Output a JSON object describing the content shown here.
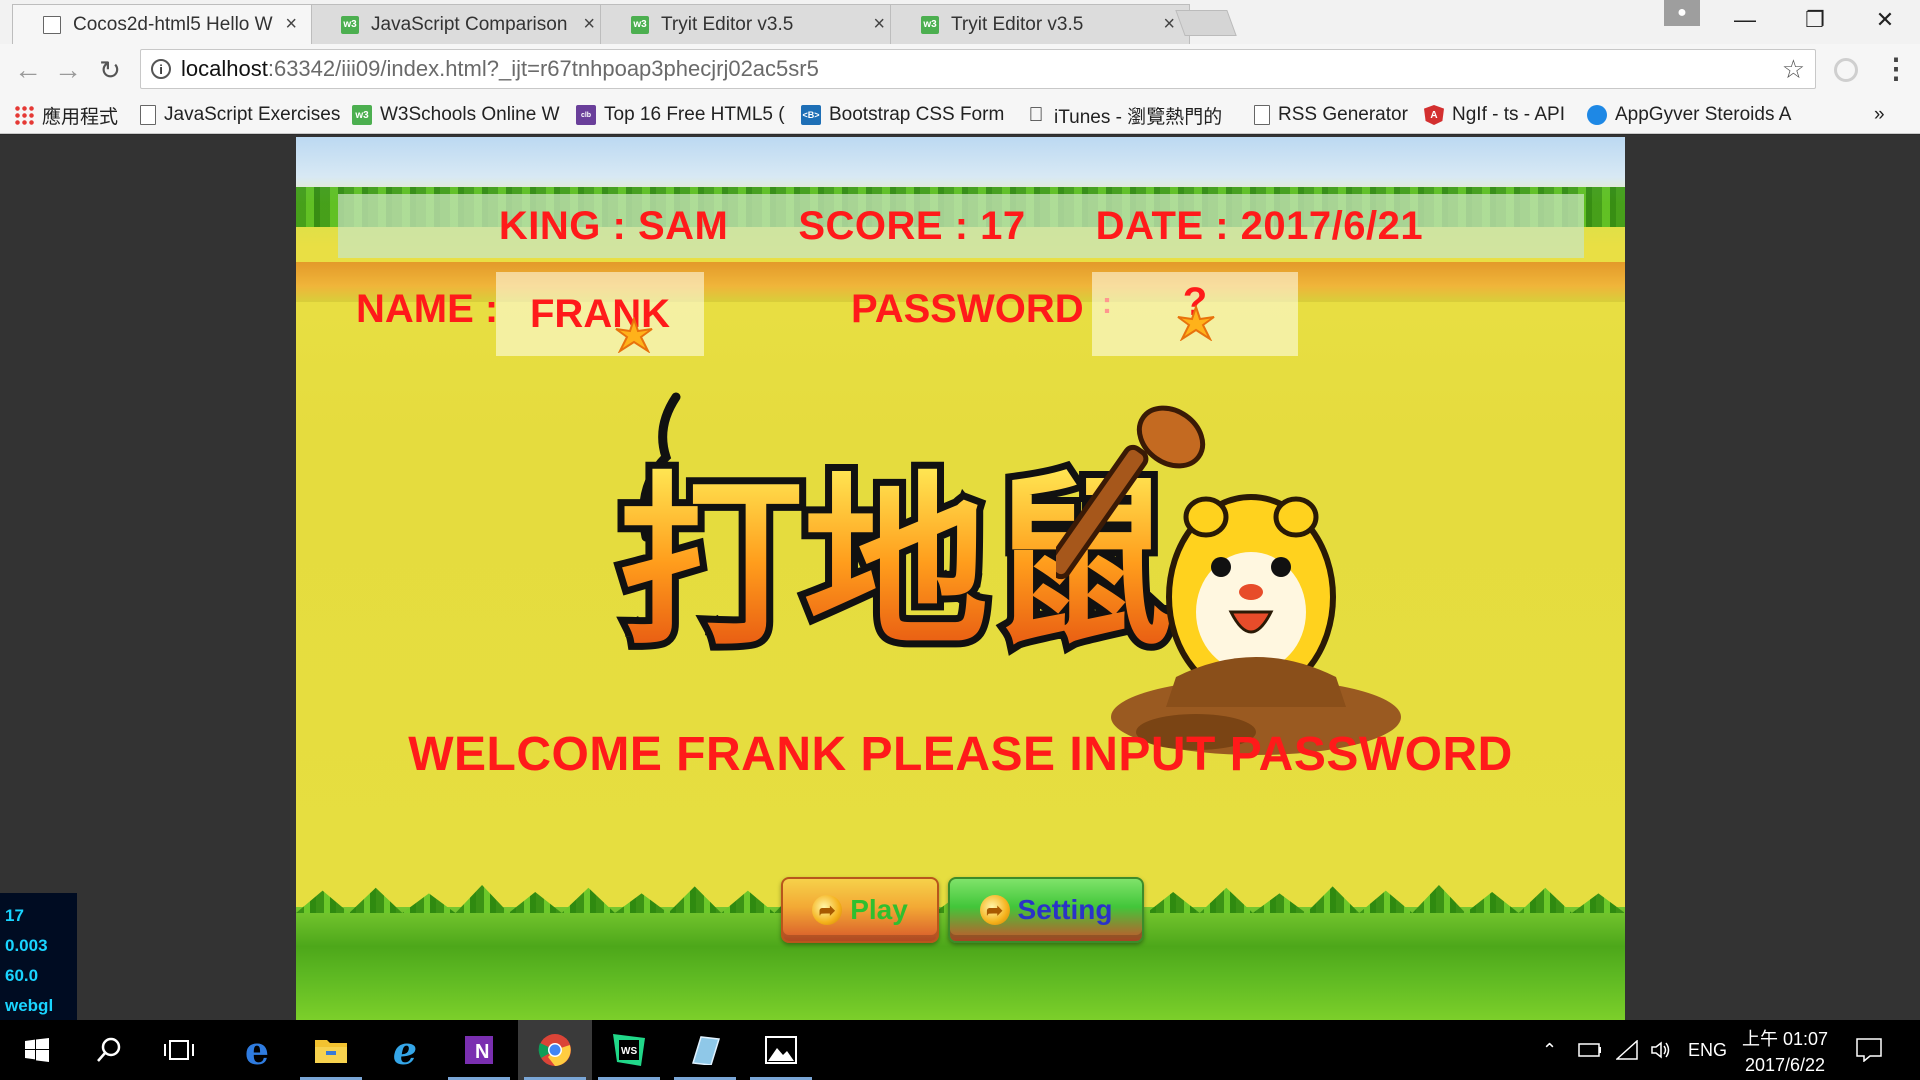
{
  "browser": {
    "tabs": [
      {
        "label": "Cocos2d-html5 Hello W",
        "icon": "page-icon",
        "active": true
      },
      {
        "label": "JavaScript Comparison",
        "icon": "w3-icon",
        "active": false
      },
      {
        "label": "Tryit Editor v3.5",
        "icon": "w3-icon",
        "active": false
      },
      {
        "label": "Tryit Editor v3.5",
        "icon": "w3-icon",
        "active": false
      }
    ],
    "close_glyph": "×",
    "address": {
      "host": "localhost",
      "rest": ":63342/iii09/index.html?_ijt=r67tnhpoap3phecjrj02ac5sr5"
    },
    "bookmarks": [
      {
        "label": "應用程式",
        "icon": "apps-icon"
      },
      {
        "label": "JavaScript Exercises",
        "icon": "page-icon"
      },
      {
        "label": "W3Schools Online W",
        "icon": "w3-icon"
      },
      {
        "label": "Top 16 Free HTML5 (",
        "icon": "colorlib-icon"
      },
      {
        "label": "Bootstrap CSS Form",
        "icon": "bootstrap-icon"
      },
      {
        "label": "iTunes - 瀏覽熱門的",
        "icon": "apple-icon"
      },
      {
        "label": "RSS Generator",
        "icon": "page-icon"
      },
      {
        "label": "NgIf - ts - API",
        "icon": "angular-icon"
      },
      {
        "label": "AppGyver Steroids A",
        "icon": "appgyver-icon"
      }
    ],
    "bookmarks_more": "»"
  },
  "game": {
    "king_label": "KING : SAM",
    "score_label": "SCORE : 17",
    "date_label": "DATE : 2017/6/21",
    "name_label": "NAME :",
    "name_value": "FRANK",
    "password_label": "PASSWORD",
    "password_sep": ":",
    "password_value": "?",
    "welcome": "WELCOME FRANK PLEASE INPUT PASSWORD",
    "play_button": "Play",
    "setting_button": "Setting",
    "logo_text": "打地鼠",
    "colors": {
      "text": "#ff1a1a",
      "play_text": "#2fbf2f",
      "setting_text": "#2a33c8"
    }
  },
  "stats": [
    "17",
    "0.003",
    "60.0",
    "webgl"
  ],
  "taskbar": {
    "apps": [
      "start-icon",
      "search-icon",
      "task-view-icon",
      "edge-icon",
      "file-explorer-icon",
      "ie-icon",
      "onenote-icon",
      "chrome-icon",
      "webstorm-icon",
      "app-icon",
      "photos-icon"
    ],
    "lang": "ENG",
    "time": "上午 01:07",
    "date": "2017/6/22"
  }
}
